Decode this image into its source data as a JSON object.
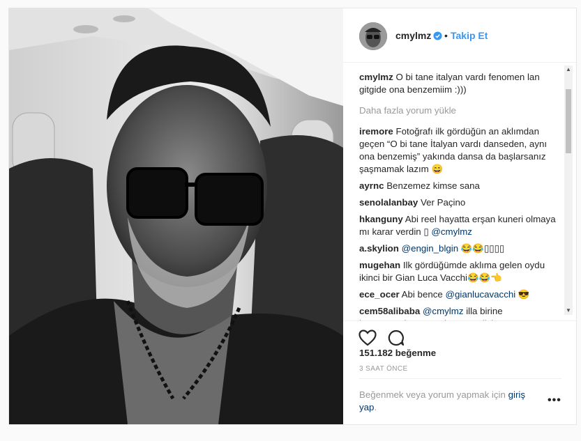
{
  "header": {
    "username": "cmylmz",
    "separator": "•",
    "follow_label": "Takip Et"
  },
  "caption": {
    "username": "cmylmz",
    "text": "O bi tane italyan vardı fenomen lan gitgide ona benzemiim :)))"
  },
  "load_more": "Daha fazla yorum yükle",
  "comments": [
    {
      "user": "iremore",
      "text": "Fotoğrafı ilk gördüğün an aklımdan geçen “O bi tane İtalyan vardı danseden, aynı ona benzemiş” yakında dansa da başlarsanız şaşmamak lazım 😄"
    },
    {
      "user": "ayrnc",
      "text": "Benzemez kimse sana"
    },
    {
      "user": "senolalanbay",
      "text": "Ver Paçino"
    },
    {
      "user": "hkanguny",
      "text": "Abi reel hayatta erşan kuneri olmaya mı karar verdin ▯ ",
      "mention": "@cmylmz"
    },
    {
      "user": "a.skylion",
      "mention": "@engin_blgin",
      "text": " 😂😂▯▯▯▯"
    },
    {
      "user": "mugehan",
      "text": "Ilk gördüğümde aklıma gelen oydu ikinci bir Gian Luca Vacchi😂😂👈"
    },
    {
      "user": "ece_ocer",
      "text": "Abi bence ",
      "mention": "@gianlucavacchi",
      "suffix": " 😎"
    },
    {
      "user": "cem58alibaba",
      "mention": "@cmylmz",
      "text": " illa birine benzeyeceksen ona benzemelisin"
    }
  ],
  "likes": "151.182 beğenme",
  "timestamp": "3 SAAT ÖNCE",
  "footer": {
    "prompt": "Beğenmek veya yorum yapmak için ",
    "link": "giriş yap",
    "suffix": "."
  },
  "options_label": "•••",
  "scroll_up": "▲",
  "scroll_down": "▼",
  "icons": {
    "verified": "verified-badge-icon",
    "heart": "heart-icon",
    "comment": "comment-icon"
  },
  "colors": {
    "accent": "#3897f0",
    "mention": "#003569",
    "muted": "#999999"
  }
}
